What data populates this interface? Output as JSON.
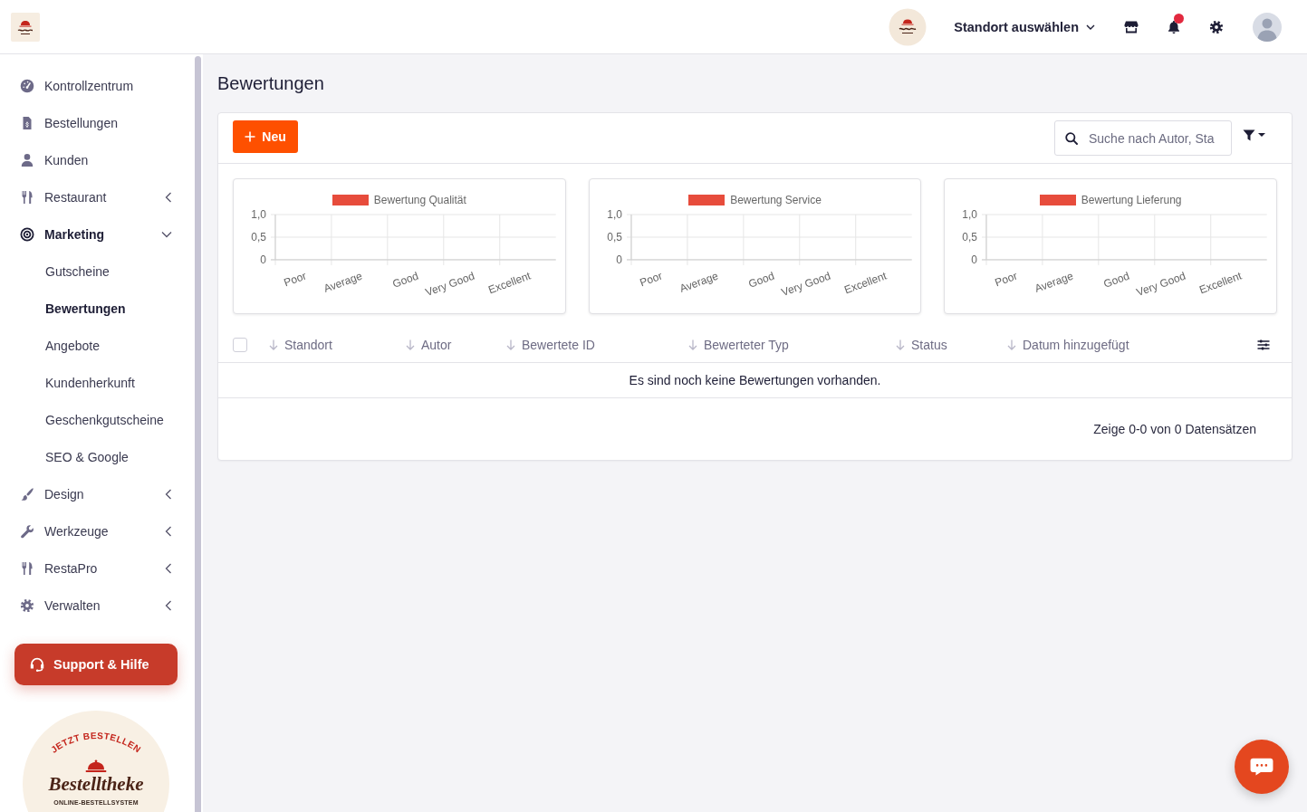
{
  "topbar": {
    "location_selector": {
      "label": "Standort auswählen"
    },
    "notifications": {
      "unread": true
    }
  },
  "sidebar": {
    "items": [
      {
        "kind": "link",
        "label": "Kontrollzentrum",
        "selected": false
      },
      {
        "kind": "link",
        "label": "Bestellungen",
        "selected": false
      },
      {
        "kind": "link",
        "label": "Kunden",
        "selected": false
      },
      {
        "kind": "group",
        "label": "Restaurant",
        "selected": false,
        "expanded": false
      },
      {
        "kind": "group",
        "label": "Marketing",
        "selected": true,
        "expanded": true,
        "children": [
          {
            "label": "Gutscheine",
            "selected": false
          },
          {
            "label": "Bewertungen",
            "selected": true
          },
          {
            "label": "Angebote",
            "selected": false
          },
          {
            "label": "Kundenherkunft",
            "selected": false
          },
          {
            "label": "Geschenkgutscheine",
            "selected": false
          },
          {
            "label": "SEO & Google",
            "selected": false
          }
        ]
      },
      {
        "kind": "group",
        "label": "Design",
        "selected": false,
        "expanded": false
      },
      {
        "kind": "group",
        "label": "Werkzeuge",
        "selected": false,
        "expanded": false
      },
      {
        "kind": "group",
        "label": "RestaPro",
        "selected": false,
        "expanded": false
      },
      {
        "kind": "group",
        "label": "Verwalten",
        "selected": false,
        "expanded": false
      }
    ],
    "support_button": {
      "label": "Support & Hilfe"
    },
    "badge": {
      "arc_text": "JETZT BESTELLEN",
      "name": "Bestelltheke",
      "tagline": "ONLINE-BESTELLSYSTEM"
    }
  },
  "page": {
    "title": "Bewertungen"
  },
  "toolbar": {
    "new_button": {
      "label": "Neu"
    },
    "search": {
      "placeholder": "Suche nach Autor, Sta"
    }
  },
  "charts": [
    {
      "chart_data": {
        "type": "bar",
        "categories": [
          "Poor",
          "Average",
          "Good",
          "Very Good",
          "Excellent"
        ],
        "series": [
          {
            "name": "Bewertung Qualität",
            "color": "#e74c3c",
            "values": [
              null,
              null,
              null,
              null,
              null
            ]
          }
        ],
        "ylim": [
          0,
          1
        ],
        "yticks": [
          {
            "value": 0,
            "label": "0"
          },
          {
            "value": 0.5,
            "label": "0,5"
          },
          {
            "value": 1,
            "label": "1,0"
          }
        ]
      }
    },
    {
      "chart_data": {
        "type": "bar",
        "categories": [
          "Poor",
          "Average",
          "Good",
          "Very Good",
          "Excellent"
        ],
        "series": [
          {
            "name": "Bewertung Service",
            "color": "#e74c3c",
            "values": [
              null,
              null,
              null,
              null,
              null
            ]
          }
        ],
        "ylim": [
          0,
          1
        ],
        "yticks": [
          {
            "value": 0,
            "label": "0"
          },
          {
            "value": 0.5,
            "label": "0,5"
          },
          {
            "value": 1,
            "label": "1,0"
          }
        ]
      }
    },
    {
      "chart_data": {
        "type": "bar",
        "categories": [
          "Poor",
          "Average",
          "Good",
          "Very Good",
          "Excellent"
        ],
        "series": [
          {
            "name": "Bewertung Lieferung",
            "color": "#e74c3c",
            "values": [
              null,
              null,
              null,
              null,
              null
            ]
          }
        ],
        "ylim": [
          0,
          1
        ],
        "yticks": [
          {
            "value": 0,
            "label": "0"
          },
          {
            "value": 0.5,
            "label": "0,5"
          },
          {
            "value": 1,
            "label": "1,0"
          }
        ]
      }
    }
  ],
  "table": {
    "select_all": {
      "checked": false
    },
    "columns": [
      {
        "label": "Standort"
      },
      {
        "label": "Autor"
      },
      {
        "label": "Bewertete ID"
      },
      {
        "label": "Bewerteter Typ"
      },
      {
        "label": "Status"
      },
      {
        "label": "Datum hinzugefügt"
      }
    ],
    "empty_message": "Es sind noch keine Bewertungen vorhanden.",
    "footer": "Zeige 0-0 von 0 Datensätzen"
  }
}
